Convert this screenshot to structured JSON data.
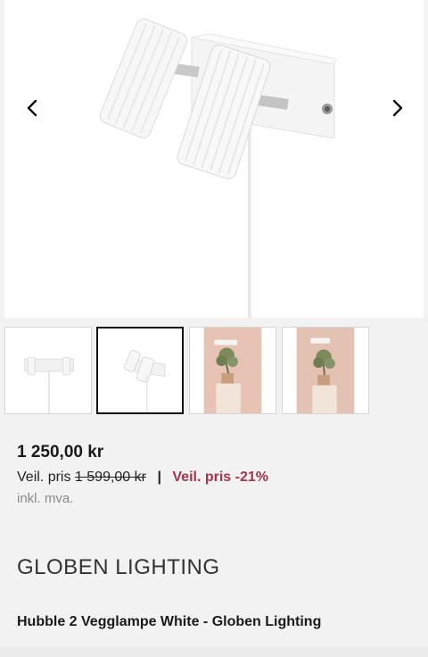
{
  "gallery": {
    "prev_icon": "chevron-left-icon",
    "next_icon": "chevron-right-icon",
    "main_image": "Hubble 2 wall lamp white, two ribbed spotlights on a bracket with cord"
  },
  "thumbnails": [
    {
      "image": "lamp-front-view",
      "active": false
    },
    {
      "image": "lamp-angled-view",
      "active": true
    },
    {
      "image": "lamp-room-plant-1",
      "active": false
    },
    {
      "image": "lamp-room-plant-2",
      "active": false
    }
  ],
  "pricing": {
    "price": "1 250,00 kr",
    "rrp_label": "Veil. pris",
    "rrp_old": "1 599,00 kr",
    "separator": "|",
    "discount": "Veil. pris -21%",
    "vat_note": "inkl. mva."
  },
  "brand": {
    "logo_text": "GLOBEN LIGHTING"
  },
  "product": {
    "title": "Hubble 2 Vegglampe White - Globen Lighting"
  },
  "colors": {
    "discount": "#a5344d",
    "background": "#f2f2f2"
  }
}
